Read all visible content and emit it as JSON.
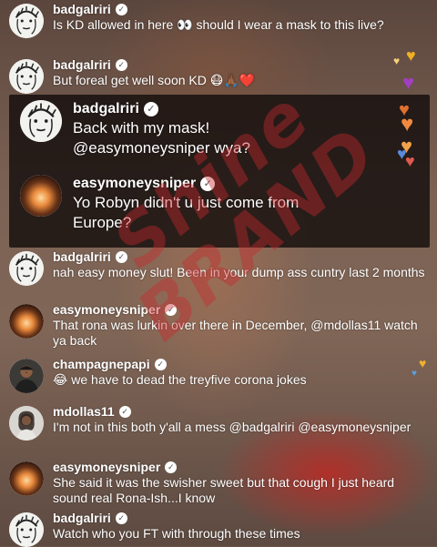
{
  "comments": [
    {
      "user": "badgalriri",
      "text": "Is KD allowed in here 👀 should I wear a mask to this live?"
    },
    {
      "user": "badgalriri",
      "text": "But foreal get well soon KD 😷🙏🏾❤️"
    },
    {
      "user": "badgalriri",
      "text": "Back with my mask! @easymoneysniper wya?"
    },
    {
      "user": "easymoneysniper",
      "text": "Yo Robyn didn't u just come from Europe?"
    },
    {
      "user": "badgalriri",
      "text": "nah easy money slut! Been in your dump ass cuntry last 2 months"
    },
    {
      "user": "easymoneysniper",
      "text": "That rona was lurkin over there in December, @mdollas11 watch ya back"
    },
    {
      "user": "champagnepapi",
      "text": "😂 we have to dead the treyfive corona jokes"
    },
    {
      "user": "mdollas11",
      "text": "I'm not in this both y'all a mess @badgalriri @easymoneysniper"
    },
    {
      "user": "easymoneysniper",
      "text": "She said it was the swisher sweet but that cough I just heard sound real Rona-Ish...I know"
    },
    {
      "user": "badgalriri",
      "text": "Watch who you FT with through these times"
    }
  ],
  "verified_icon": "verified-check-icon",
  "watermark": [
    "Shine",
    "BRAND"
  ],
  "colors": {
    "watermark": "#c8282d",
    "text": "#ffffff"
  }
}
